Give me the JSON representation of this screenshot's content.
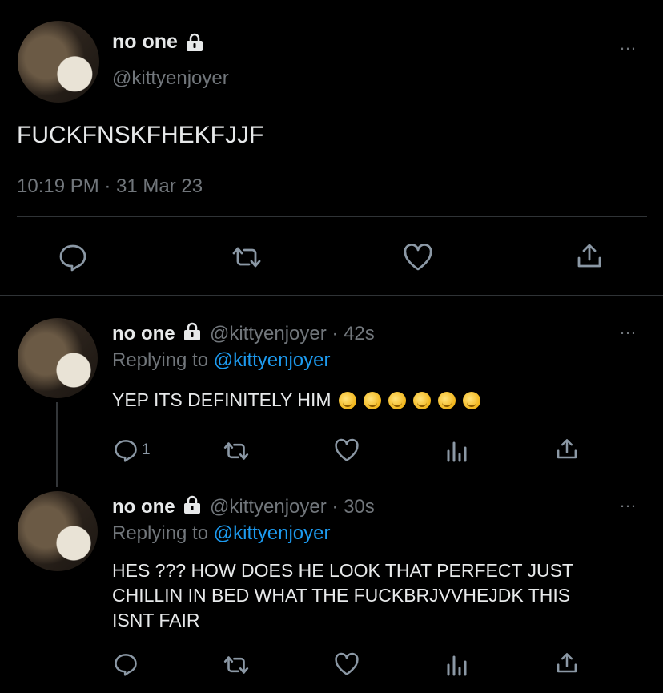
{
  "main_tweet": {
    "display_name": "no one",
    "handle": "@kittyenjoyer",
    "text": "FUCKFNSKFHEKFJJF",
    "timestamp": "10:19 PM · 31 Mar 23",
    "actions": [
      "reply-icon",
      "retweet-icon",
      "like-icon",
      "share-icon"
    ]
  },
  "replies": [
    {
      "display_name": "no one",
      "handle": "@kittyenjoyer",
      "age": "· 42s",
      "replying_label": "Replying to",
      "replying_to": "@kittyenjoyer",
      "text": "YEP ITS DEFINITELY HIM",
      "emoji_count": 6,
      "emoji_name": "melting-face-emoji",
      "reply_count": "1"
    },
    {
      "display_name": "no one",
      "handle": "@kittyenjoyer",
      "age": "· 30s",
      "replying_label": "Replying to",
      "replying_to": "@kittyenjoyer",
      "text_lines": [
        "HES ??? HOW DOES HE LOOK THAT PERFECT JUST",
        "CHILLIN IN BED WHAT THE FUCKBRJVVHEJDK THIS",
        "ISNT FAIR"
      ],
      "reply_count": ""
    }
  ],
  "more_icon": "…",
  "colors": {
    "background": "#000000",
    "text": "#e7e9ea",
    "muted": "#71767b",
    "link": "#1d9bf0",
    "divider": "#2f3336"
  }
}
